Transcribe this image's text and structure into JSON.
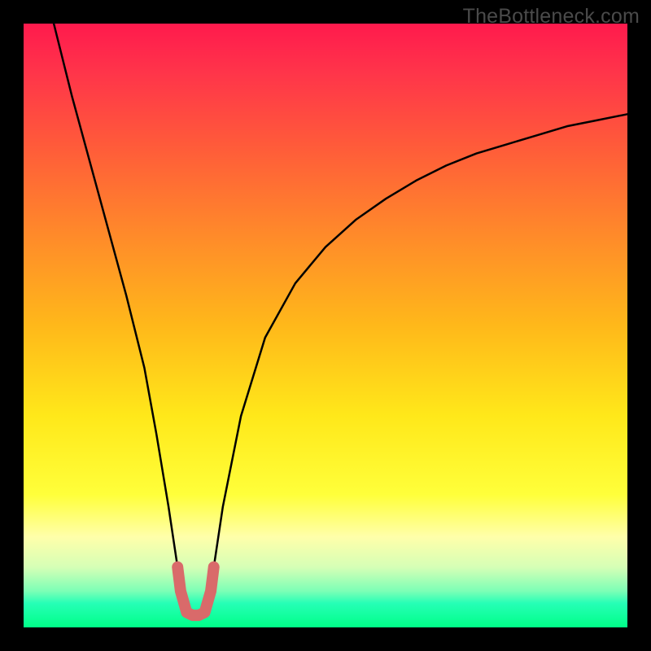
{
  "watermark": "TheBottleneck.com",
  "chart_data": {
    "type": "line",
    "title": "",
    "xlabel": "",
    "ylabel": "",
    "xlim": [
      0,
      100
    ],
    "ylim": [
      0,
      100
    ],
    "grid": false,
    "background_gradient": [
      "#ff1a4d",
      "#ff344a",
      "#ff5a3a",
      "#ff8a2a",
      "#ffb81a",
      "#ffe81a",
      "#ffff3a",
      "#ffffaa",
      "#d6ffb6",
      "#7cffb6",
      "#26ffb6",
      "#00ff88"
    ],
    "series": [
      {
        "name": "bottleneck-curve",
        "color": "#000000",
        "x": [
          5,
          8,
          11,
          14,
          17,
          20,
          22,
          24,
          25.5,
          27,
          28.5,
          30,
          31.5,
          33,
          36,
          40,
          45,
          50,
          55,
          60,
          65,
          70,
          75,
          80,
          85,
          90,
          95,
          100
        ],
        "values": [
          100,
          88,
          77,
          66,
          55,
          43,
          32,
          20,
          10,
          2.5,
          2.5,
          2.5,
          10,
          20,
          35,
          48,
          57,
          63,
          67.5,
          71,
          74,
          76.5,
          78.5,
          80,
          81.5,
          83,
          84,
          85
        ]
      },
      {
        "name": "bottleneck-curve-highlight",
        "color": "#d96a6a",
        "x": [
          25.5,
          26.0,
          27.0,
          28.0,
          29.0,
          30.0,
          31.0,
          31.5
        ],
        "values": [
          10,
          6,
          2.5,
          2.0,
          2.0,
          2.5,
          6,
          10
        ]
      }
    ]
  }
}
